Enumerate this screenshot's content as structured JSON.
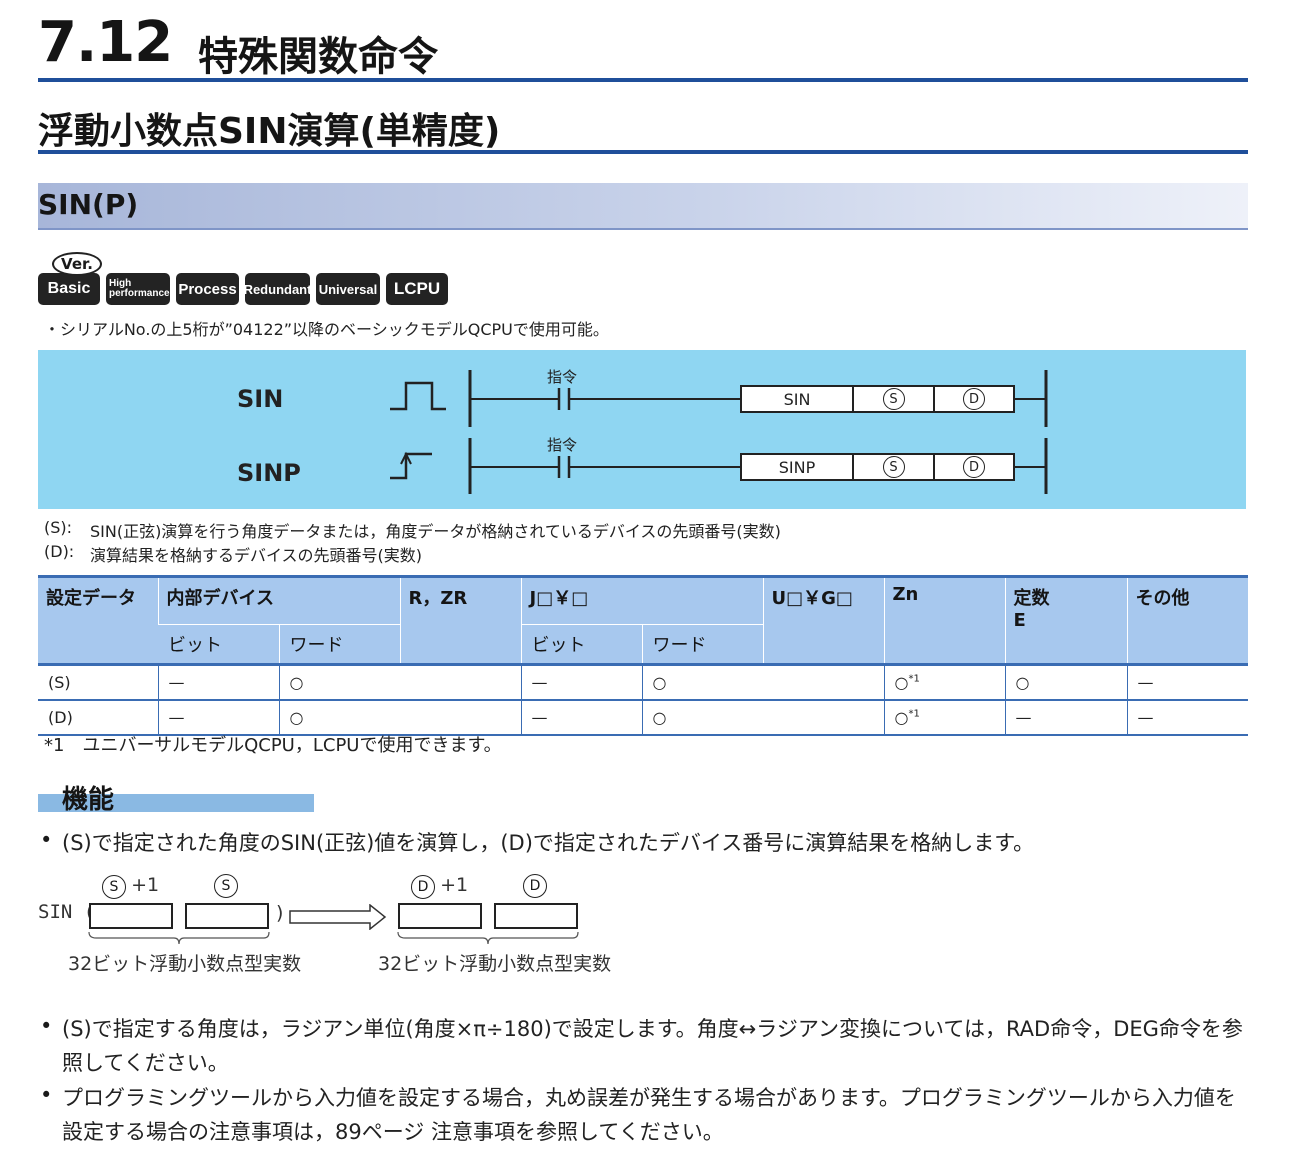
{
  "header": {
    "chapter_number": "7.12",
    "chapter_title": "特殊関数命令",
    "instruction_title": "浮動小数点SIN演算(単精度)",
    "mnemonic": "SIN(P)"
  },
  "badges": {
    "ver": "Ver.",
    "basic": "Basic",
    "high_line1": "High",
    "high_line2": "performance",
    "process": "Process",
    "redundant": "Redundant",
    "universal": "Universal",
    "lcpu": "LCPU"
  },
  "serial_note": "・シリアルNo.の上5桁が”04122”以降のベーシックモデルQCPUで使用可能。",
  "ladder": {
    "row1_label": "SIN",
    "row2_label": "SINP",
    "contact_label": "指令",
    "op1": "SIN",
    "op2": "SINP",
    "s": "S",
    "d": "D"
  },
  "operand_desc": {
    "s_key": "(S):",
    "s_text": "SIN(正弦)演算を行う角度データまたは，角度データが格納されているデバイスの先頭番号(実数)",
    "d_key": "(D):",
    "d_text": "演算結果を格納するデバイスの先頭番号(実数)"
  },
  "table": {
    "headers": {
      "setting": "設定データ",
      "internal": "内部デバイス",
      "rzr": "R，ZR",
      "j": "J□￥□",
      "ug": "U□￥G□",
      "zn": "Zn",
      "const_line1": "定数",
      "const_line2": "E",
      "other": "その他",
      "bit": "ビット",
      "word": "ワード",
      "bit2": "ビット",
      "word2": "ワード"
    },
    "rows": [
      {
        "name": "(S)",
        "c1": "—",
        "c2": "○",
        "c3": "—",
        "c4": "○",
        "zn": "○",
        "zn_sup": "*1",
        "const": "○",
        "other": "—"
      },
      {
        "name": "(D)",
        "c1": "—",
        "c2": "○",
        "c3": "—",
        "c4": "○",
        "zn": "○",
        "zn_sup": "*1",
        "const": "—",
        "other": "—"
      }
    ]
  },
  "footnote": "*1　ユニバーサルモデルQCPU，LCPUで使用できます。",
  "function_heading": "機能",
  "function": {
    "bullet": "•",
    "p1": "(S)で指定された角度のSIN(正弦)値を演算し，(D)で指定されたデバイス番号に演算結果を格納します。",
    "p2": "(S)で指定する角度は，ラジアン単位(角度×π÷180)で設定します。角度↔ラジアン変換については，RAD命令，DEG命令を参照してください。",
    "p3": "プログラミングツールから入力値を設定する場合，丸め誤差が発生する場合があります。プログラミングツールから入力値を設定する場合の注意事項は，89ページ 注意事項を参照してください。"
  },
  "diagram": {
    "sin": "SIN (",
    "close": ")",
    "plus1": "+1",
    "s": "S",
    "d": "D",
    "caption": "32ビット浮動小数点型実数"
  }
}
